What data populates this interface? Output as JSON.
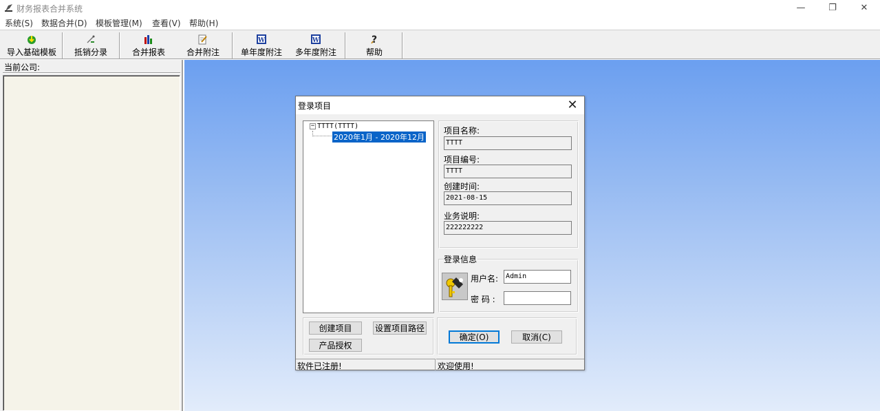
{
  "window": {
    "title": "财务报表合并系统",
    "minimize": "—",
    "restore": "❐",
    "close": "✕"
  },
  "menu": [
    "系统(S)",
    "数据合并(D)",
    "模板管理(M)",
    "查看(V)",
    "帮助(H)"
  ],
  "toolbar": {
    "import_label": "导入基础模板",
    "offset_label": "抵销分录",
    "merge_report_label": "合并报表",
    "merge_notes_label": "合并附注",
    "single_year_label": "单年度附注",
    "multi_year_label": "多年度附注",
    "help_label": "帮助"
  },
  "left_panel": {
    "current_company_label": "当前公司:"
  },
  "dialog": {
    "title": "登录项目",
    "close": "✕",
    "tree": {
      "root_toggle": "−",
      "root": "TTTT(TTTT)",
      "child": "2020年1月 - 2020年12月"
    },
    "project_name_label": "项目名称:",
    "project_name": "TTTT",
    "project_code_label": "项目编号:",
    "project_code": "TTTT",
    "created_label": "创建时间:",
    "created": "2021-08-15",
    "business_desc_label": "业务说明:",
    "business_desc": "222222222",
    "login_info_label": "登录信息",
    "username_label": "用户名:",
    "username": "Admin",
    "password_label": "密 码 :",
    "password": "",
    "create_project_btn": "创建项目",
    "set_path_btn": "设置项目路径",
    "license_btn": "产品授权",
    "ok_btn": "确定(O)",
    "cancel_btn": "取消(C)",
    "status_left": "软件已注册!",
    "status_right": "欢迎使用!"
  }
}
